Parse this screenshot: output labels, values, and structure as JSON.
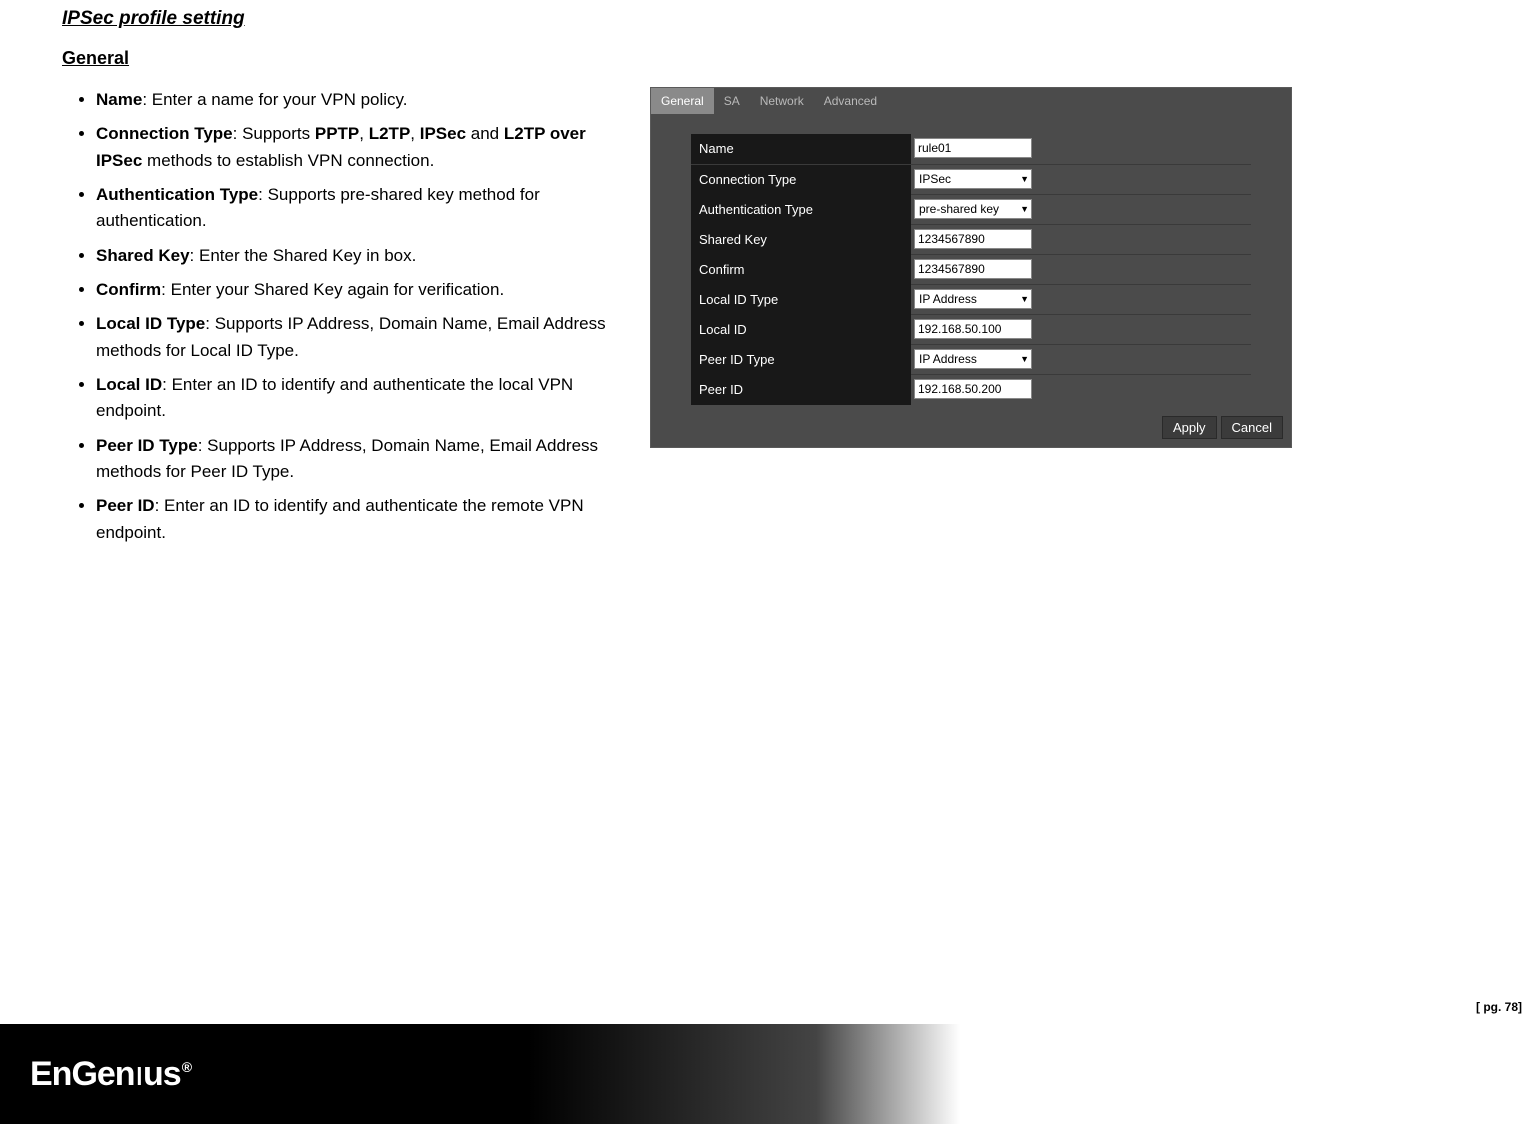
{
  "doc": {
    "section_title": "IPSec profile setting",
    "subsection_title": "General",
    "bullets": {
      "name": {
        "head": "Name",
        "text": ": Enter a name for your VPN policy."
      },
      "conn_type": {
        "head": "Connection Type",
        "pre": ": Supports ",
        "b1": "PPTP",
        "s1": ", ",
        "b2": "L2TP",
        "s2": ", ",
        "b3": "IPSec",
        "s3": " and ",
        "b4": "L2TP over IPSec",
        "post": " methods to establish VPN connection."
      },
      "auth_type": {
        "head": "Authentication Type",
        "text": ": Supports pre-shared key method for authentication."
      },
      "shared_key": {
        "head": "Shared Key",
        "text": ": Enter the Shared Key in box."
      },
      "confirm": {
        "head": "Confirm",
        "text": ": Enter your Shared Key again for verification."
      },
      "local_id_type": {
        "head": "Local ID Type",
        "text": ": Supports IP Address, Domain Name, Email Address methods for Local ID Type."
      },
      "local_id": {
        "head": "Local ID",
        "text": ": Enter an ID to identify and authenticate the local VPN endpoint."
      },
      "peer_id_type": {
        "head": "Peer ID Type",
        "text": ": Supports IP Address, Domain Name, Email Address methods for Peer ID Type."
      },
      "peer_id": {
        "head": "Peer ID",
        "text": ": Enter an ID to identify and authenticate the remote VPN endpoint."
      }
    }
  },
  "panel": {
    "tabs": {
      "t0": "General",
      "t1": "SA",
      "t2": "Network",
      "t3": "Advanced"
    },
    "rows": {
      "name": {
        "label": "Name",
        "value": "rule01"
      },
      "conn_type": {
        "label": "Connection Type",
        "value": "IPSec"
      },
      "auth_type": {
        "label": "Authentication Type",
        "value": "pre-shared key"
      },
      "shared_key": {
        "label": "Shared Key",
        "value": "1234567890"
      },
      "confirm": {
        "label": "Confirm",
        "value": "1234567890"
      },
      "local_id_type": {
        "label": "Local ID Type",
        "value": "IP Address"
      },
      "local_id": {
        "label": "Local ID",
        "value": "192.168.50.100"
      },
      "peer_id_type": {
        "label": "Peer ID Type",
        "value": "IP Address"
      },
      "peer_id": {
        "label": "Peer ID",
        "value": "192.168.50.200"
      }
    },
    "buttons": {
      "apply": "Apply",
      "cancel": "Cancel"
    }
  },
  "footer": {
    "logo_pre": "EnGen",
    "logo_post": "us",
    "logo_reg": "®",
    "page": "[ pg. 78]"
  }
}
